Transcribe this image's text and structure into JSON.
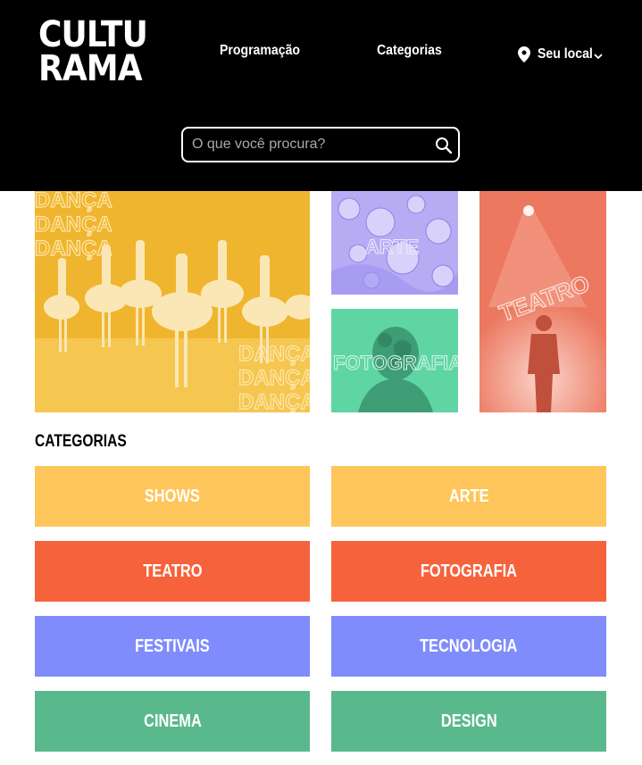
{
  "header": {
    "logo": {
      "line1": "CULTU",
      "line2": "RAMA"
    },
    "nav": {
      "programacao": "Programação",
      "categorias": "Categorias",
      "local": "Seu local"
    },
    "search": {
      "placeholder": "O que você procura?"
    }
  },
  "hero": {
    "danca_word": "DANÇA",
    "arte_word": "ARTE",
    "foto_word": "FOTOGRAFIA",
    "teatro_word": "TEATRO"
  },
  "categories": {
    "title": "CATEGORIAS",
    "items": [
      {
        "label": "SHOWS",
        "color": "#fec65a"
      },
      {
        "label": "ARTE",
        "color": "#fec65a"
      },
      {
        "label": "TEATRO",
        "color": "#f6623b"
      },
      {
        "label": "FOTOGRAFIA",
        "color": "#f6623b"
      },
      {
        "label": "FESTIVAIS",
        "color": "#808cfc"
      },
      {
        "label": "TECNOLOGIA",
        "color": "#808cfc"
      },
      {
        "label": "CINEMA",
        "color": "#5ab98c"
      },
      {
        "label": "DESIGN",
        "color": "#5ab98c"
      }
    ]
  }
}
